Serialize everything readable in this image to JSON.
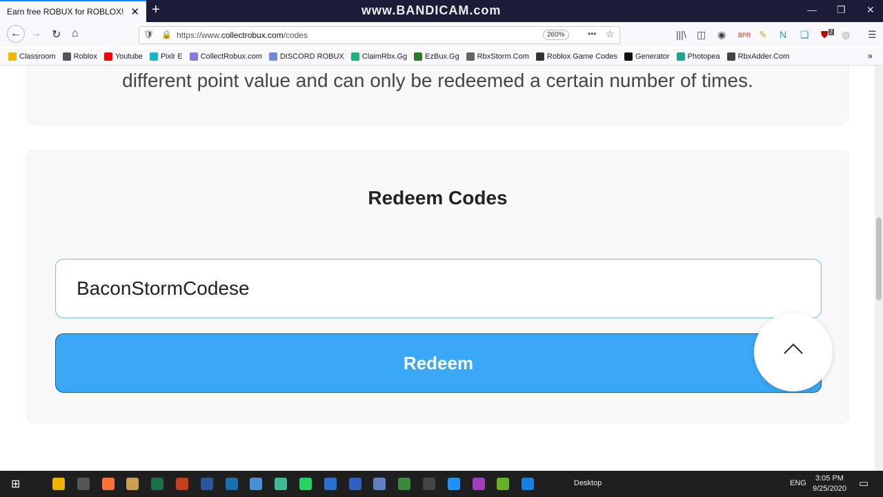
{
  "browser": {
    "tab_title": "Earn free ROBUX for ROBLOX!",
    "recorder_watermark": "www.BANDICAM.com",
    "url_prefix": "https://www.",
    "url_domain": "collectrobux.com",
    "url_path": "/codes",
    "zoom": "260%",
    "extension_badge": "2"
  },
  "bookmarks": [
    {
      "label": "Classroom",
      "color": "#f4b400"
    },
    {
      "label": "Roblox",
      "color": "#555"
    },
    {
      "label": "Youtube",
      "color": "#ff0000"
    },
    {
      "label": "Pixlr E",
      "color": "#19b5c8"
    },
    {
      "label": "CollectRobux.com",
      "color": "#8a7bd8"
    },
    {
      "label": "DISCORD ROBUX",
      "color": "#7289da"
    },
    {
      "label": "ClaimRbx.Gg",
      "color": "#1bb37a"
    },
    {
      "label": "EzBux.Gg",
      "color": "#2a7a2a"
    },
    {
      "label": "RbxStorm.Com",
      "color": "#666"
    },
    {
      "label": "Roblox Game Codes",
      "color": "#333"
    },
    {
      "label": "Generator",
      "color": "#111"
    },
    {
      "label": "Photopea",
      "color": "#18a497"
    },
    {
      "label": "RbxAdder.Com",
      "color": "#444"
    }
  ],
  "page": {
    "intro_text": "different point value and can only be redeemed a certain number of times.",
    "redeem_title": "Redeem Codes",
    "code_input_value": "BaconStormCodese",
    "redeem_button": "Redeem",
    "accent": "#3aa8f7"
  },
  "taskbar": {
    "desktop_label": "Desktop",
    "language": "ENG",
    "time": "3:05 PM",
    "date": "9/25/2020"
  }
}
